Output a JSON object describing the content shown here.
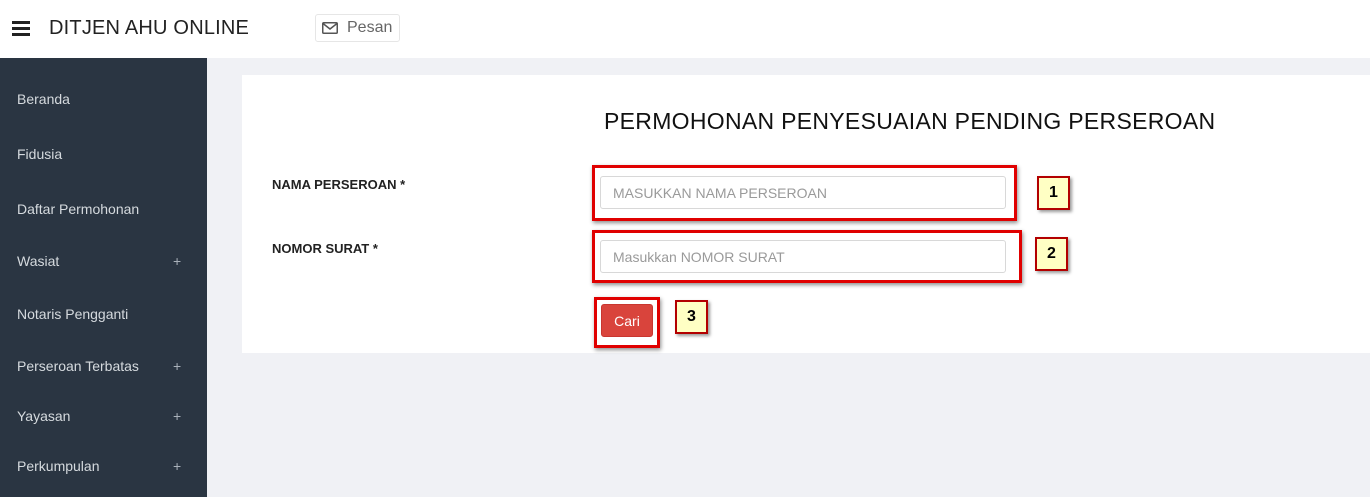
{
  "header": {
    "title": "DITJEN AHU ONLINE",
    "pesan_label": "Pesan",
    "menu_icon": "hamburger-icon",
    "pesan_icon": "envelope-icon"
  },
  "sidebar": {
    "items": [
      {
        "label": "Beranda",
        "expand": ""
      },
      {
        "label": "Fidusia",
        "expand": ""
      },
      {
        "label": "Daftar Permohonan",
        "expand": ""
      },
      {
        "label": "Wasiat",
        "expand": "+"
      },
      {
        "label": "Notaris Pengganti",
        "expand": ""
      },
      {
        "label": "Perseroan Terbatas",
        "expand": "+"
      },
      {
        "label": "Yayasan",
        "expand": "+"
      },
      {
        "label": "Perkumpulan",
        "expand": "+"
      }
    ]
  },
  "form": {
    "title": "PERMOHONAN PENYESUAIAN PENDING PERSEROAN",
    "nama": {
      "label": "NAMA PERSEROAN *",
      "placeholder": "MASUKKAN NAMA PERSEROAN",
      "value": ""
    },
    "nomor": {
      "label": "NOMOR SURAT *",
      "placeholder": "Masukkan NOMOR SURAT",
      "value": ""
    },
    "submit_label": "Cari"
  },
  "annotations": {
    "callout_1": "1",
    "callout_2": "2",
    "callout_3": "3"
  },
  "colors": {
    "sidebar_bg": "#2a3542",
    "content_bg": "#f0f1f5",
    "button_danger": "#d9443c",
    "highlight_red": "#e00000",
    "callout_bg": "#ffffc4"
  }
}
